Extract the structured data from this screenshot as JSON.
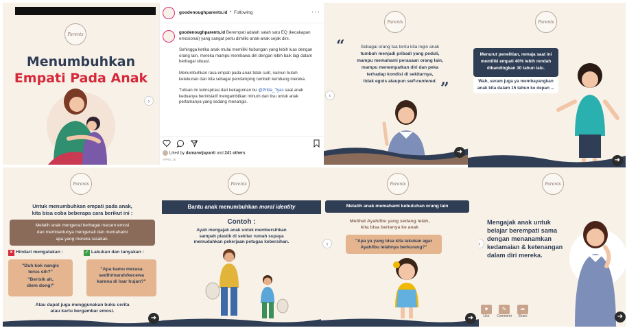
{
  "colors": {
    "cream": "#f8f1e8",
    "navy": "#2f3e55",
    "teal": "#3aa6a0",
    "brown_box": "#8a6a58",
    "peach_box": "#e5b58f",
    "red": "#d62a3a",
    "green": "#3a9e4b"
  },
  "brand_logo_text": "Parents",
  "slide1": {
    "title_line1": "Menumbuhkan",
    "title_line2": "Empati Pada Anak"
  },
  "post": {
    "username": "goodenoughparents.id",
    "follow_separator": "•",
    "follow_label": "Following",
    "more_icon": "more-dots-icon",
    "caption_username": "goodenoughparents.id",
    "caption_p1": "Berempati adalah salah satu EQ (kecakapan emosional) yang sangat perlu dimiliki anak-anak sejak dini.",
    "caption_p2": "Sehingga ketika anak mulai memiliki hubungan yang lebih luas dengan orang lain, mereka mampu membawa diri dengan lebih baik lagi dalam berbagai situasi.",
    "caption_p3": "Menumbuhkan rasa empati pada anak tidak sulit, namun butuh ketekunan dan kita sebagai pendamping tumbuh kembang mereka.",
    "caption_p4_prefix": "Tulisan ini terinspirasi dari kekaguman bu ",
    "caption_p4_mention": "@Pritta_Tyas",
    "caption_p4_suffix": " saat anak keduanya berinisiatif mengambilkan minum dan tisu untuk anak pertamanya yang sedang menangis.",
    "liked_by_prefix": "Liked by",
    "liked_by_user": "damarwijayanti",
    "liked_by_and": "and",
    "liked_by_count": "241 others",
    "date": "APRIL 15"
  },
  "slide3": {
    "quote_open": "“",
    "quote_close": "”",
    "line1": "Sebagai orang tua tentu kita ingin anak",
    "line2": "tumbuh menjadi pribadi yang peduli,",
    "line3": "mampu memahami perasaan orang lain,",
    "line4": "mampu menempatkan diri dan peka",
    "line5": "terhadap kondisi di sekitarnya,",
    "line6_prefix": "tidak egois ataupun ",
    "line6_italic": "self-centered."
  },
  "slide4": {
    "research_line1": "Menurut penelitian, remaja saat ini",
    "research_line2": "memiliki empati 40% lebih rendah",
    "research_line3": "dibandingkan 30 tahun lalu.",
    "wow_line1": "Wah, seram juga ya membayangkan",
    "wow_line2": "anak kita dalam 15 tahun ke depan ..."
  },
  "slide5": {
    "intro_line1": "Untuk menumbuhkan empati pada anak,",
    "intro_line2": "kita bisa coba beberapa cara berikut ini :",
    "box_line1": "Melatih anak mengenal berbagai macam emosi",
    "box_line2": "dan membantunya mengenali dan memahami",
    "box_line3": "apa yang mereka rasakan.",
    "avoid_mark": "✕",
    "avoid_label": "Hindari mengatakan :",
    "do_mark": "✓",
    "do_label": "Lakukan dan tanyakan :",
    "avoid_q1_line1": "\"Duh kok nangis",
    "avoid_q1_line2": "terus sih?\"",
    "avoid_q2_line1": "\"Berisik ah,",
    "avoid_q2_line2": "diem dong!\"",
    "do_q_line1": "\"Apa kamu merasa",
    "do_q_line2": "sedih/marah/kecewa",
    "do_q_line3": "karena di luar hujan?\"",
    "footer_line1": "Atau dapat juga menggunakan buku cerita",
    "footer_line2": "atau kartu bergambar emosi."
  },
  "slide6": {
    "banner_prefix": "Bantu anak menumbuhkan ",
    "banner_italic": "moral identity",
    "contoh": "Contoh :",
    "example_line1": "Ayah mengajak anak untuk membersihkan",
    "example_line2": "sampah plastik di sekitar rumah supaya",
    "example_line3": "memudahkan pekerjaan petugas kebersihan."
  },
  "slide7": {
    "banner": "Melatih anak memahami kebutuhan orang lain",
    "sub_line1": "Melihat Ayah/Ibu yang sedang lelah,",
    "sub_line2": "kita bisa bertanya ke anak",
    "q_line1": "\"Apa ya yang bisa kita lakukan agar",
    "q_line2": "Ayah/Ibu lelahnya berkurang?\""
  },
  "slide8": {
    "line1": "Mengajak anak untuk",
    "line2": "belajar berempati sama",
    "line3": "dengan menanamkan",
    "line4": "kedamaian & ketenangan",
    "line5": "dalam diri mereka.",
    "action_like": "Like",
    "action_comment": "Comment",
    "action_share": "Share"
  }
}
